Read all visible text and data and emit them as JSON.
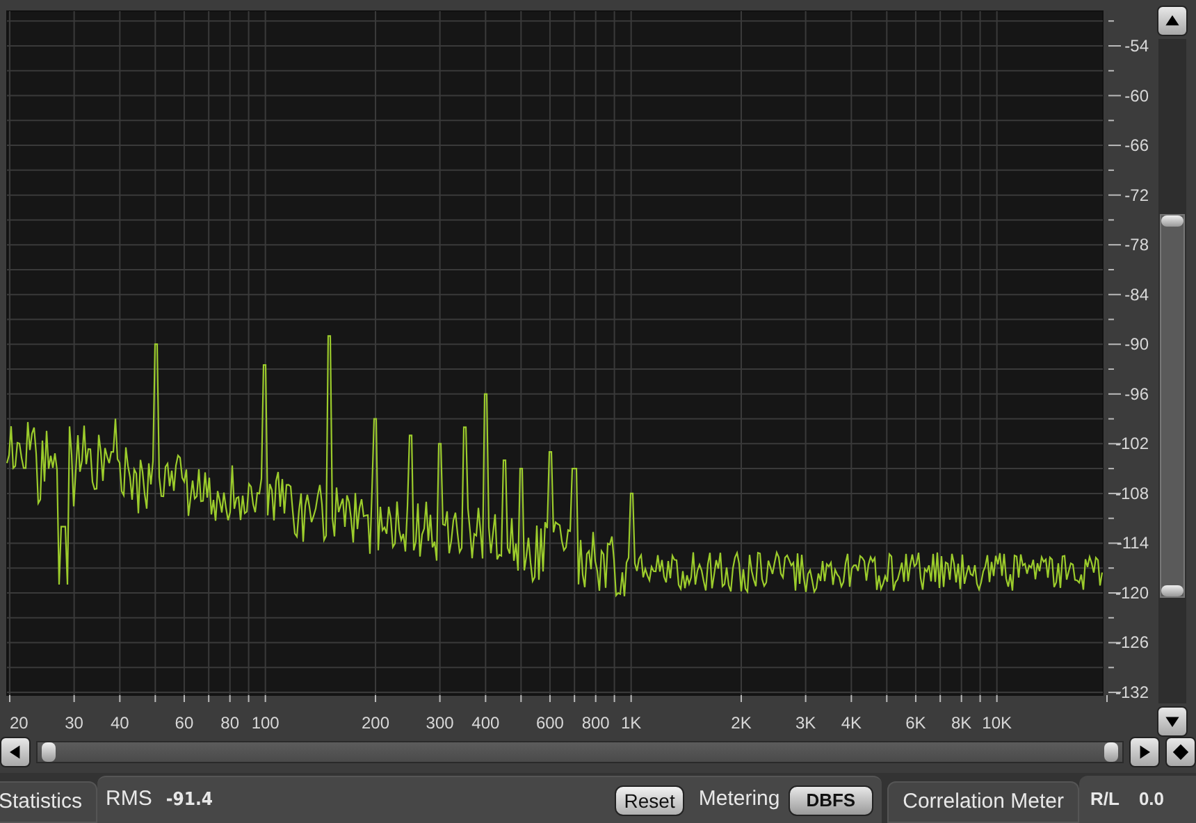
{
  "spectrum": {
    "x_ticks": [
      "20",
      "30",
      "40",
      "60",
      "80",
      "100",
      "200",
      "300",
      "400",
      "600",
      "800",
      "1K",
      "2K",
      "3K",
      "4K",
      "6K",
      "8K",
      "10K"
    ],
    "y_ticks": [
      "-54",
      "-60",
      "-66",
      "-72",
      "-78",
      "-84",
      "-90",
      "-96",
      "-102",
      "-108",
      "-114",
      "-120",
      "-126",
      "-132"
    ]
  },
  "statistics": {
    "tab": "Statistics",
    "rms_label": "RMS",
    "rms_value": "-91.4",
    "reset": "Reset",
    "metering_label": "Metering",
    "metering_mode": "DBFS"
  },
  "correlation": {
    "tab": "Correlation Meter",
    "label": "R/L",
    "value": "0.0"
  }
}
